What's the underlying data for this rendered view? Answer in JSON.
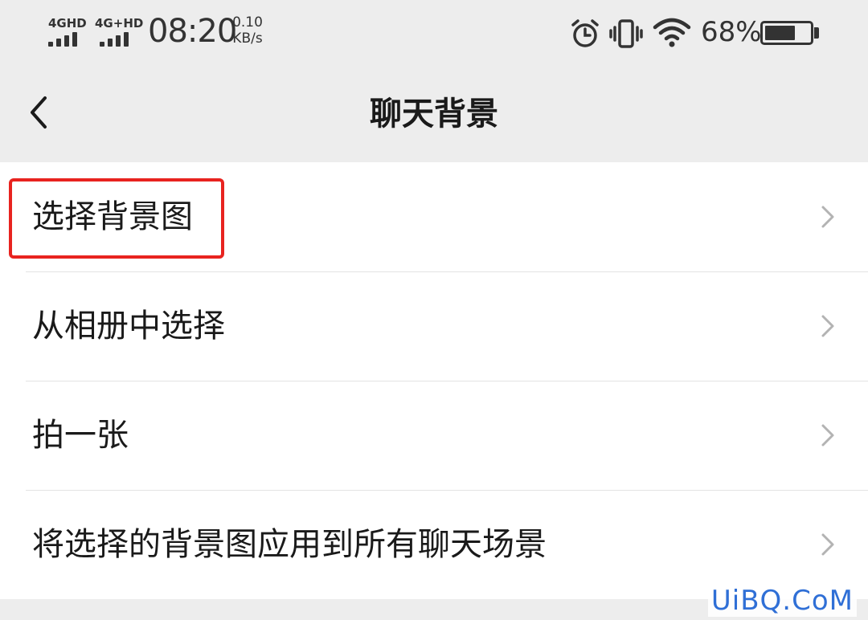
{
  "status_bar": {
    "signal_1_label": "4GHD",
    "signal_2_label": "4G+HD",
    "time": "08:20",
    "speed_value": "0.10",
    "speed_unit": "KB/s",
    "alarm_icon": "alarm-clock-icon",
    "vibrate_icon": "vibrate-icon",
    "wifi_icon": "wifi-icon",
    "battery_percent": "68%",
    "battery_level": 0.68
  },
  "nav": {
    "back_icon": "chevron-left-icon",
    "title": "聊天背景"
  },
  "list": {
    "items": [
      {
        "label": "选择背景图",
        "highlighted": true
      },
      {
        "label": "从相册中选择",
        "highlighted": false
      },
      {
        "label": "拍一张",
        "highlighted": false
      },
      {
        "label": "将选择的背景图应用到所有聊天场景",
        "highlighted": false
      }
    ],
    "chevron_icon": "chevron-right-icon"
  },
  "colors": {
    "highlight_border": "#e8231f",
    "background": "#ededed",
    "list_background": "#ffffff",
    "watermark": "#2f6fd6"
  },
  "watermark": "UiBQ.CoM"
}
